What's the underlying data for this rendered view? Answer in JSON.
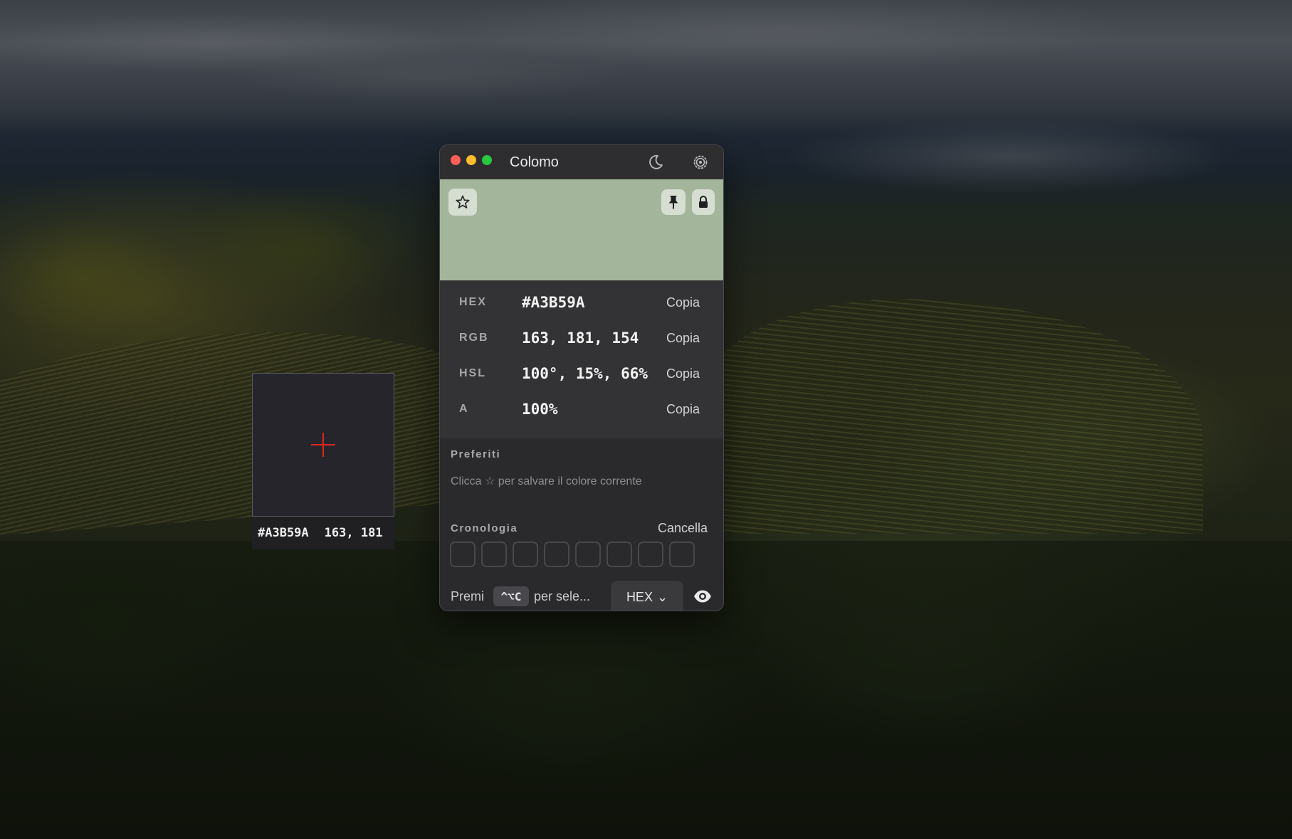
{
  "app": {
    "title": "Colomo"
  },
  "colors": {
    "current": "#A3B59A",
    "accent_red": "#e0261f"
  },
  "loupe": {
    "hex": "#A3B59A",
    "rgb_partial": "163, 181"
  },
  "values": [
    {
      "label": "HEX",
      "value": "#A3B59A",
      "copy": "Copia"
    },
    {
      "label": "RGB",
      "value": "163, 181, 154",
      "copy": "Copia"
    },
    {
      "label": "HSL",
      "value": "100°, 15%, 66%",
      "copy": "Copia"
    },
    {
      "label": "A",
      "value": "100%",
      "copy": "Copia"
    }
  ],
  "favorites": {
    "title": "Preferiti",
    "hint": "Clicca ☆ per salvare il colore corrente"
  },
  "history": {
    "title": "Cronologia",
    "clear_label": "Cancella",
    "slots": 8
  },
  "footer": {
    "prefix": "Premi",
    "shortcut": "^⌥C",
    "suffix": "per sele...",
    "format": "HEX",
    "format_chevron": "⌄"
  },
  "icons": {
    "titlebar": [
      "moon-icon",
      "gear-icon"
    ],
    "swatch": [
      "star-icon",
      "pin-icon",
      "lock-icon"
    ],
    "footer": [
      "eye-icon"
    ]
  }
}
